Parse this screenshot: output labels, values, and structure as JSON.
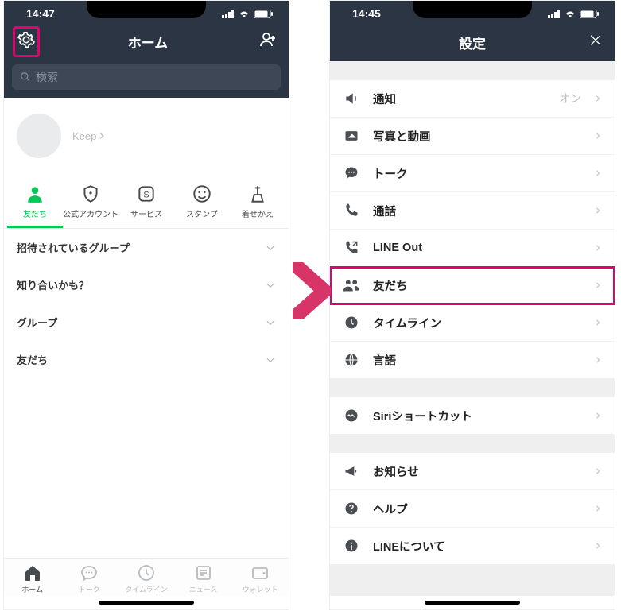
{
  "left": {
    "status_time": "14:47",
    "nav_title": "ホーム",
    "search_placeholder": "検索",
    "keep_label": "Keep",
    "tabs": [
      {
        "label": "友だち"
      },
      {
        "label": "公式アカウント"
      },
      {
        "label": "サービス"
      },
      {
        "label": "スタンプ"
      },
      {
        "label": "着せかえ"
      }
    ],
    "sections": [
      {
        "label": "招待されているグループ"
      },
      {
        "label": "知り合いかも？"
      },
      {
        "label": "グループ"
      },
      {
        "label": "友だち"
      }
    ],
    "bottom": [
      {
        "label": "ホーム"
      },
      {
        "label": "トーク"
      },
      {
        "label": "タイムライン"
      },
      {
        "label": "ニュース"
      },
      {
        "label": "ウォレット"
      }
    ]
  },
  "right": {
    "status_time": "14:45",
    "nav_title": "設定",
    "group1": [
      {
        "name": "通知",
        "value": "オン",
        "icon": "speaker"
      },
      {
        "name": "写真と動画",
        "icon": "photo"
      },
      {
        "name": "トーク",
        "icon": "chat"
      },
      {
        "name": "通話",
        "icon": "phone"
      },
      {
        "name": "LINE Out",
        "icon": "phone-out"
      },
      {
        "name": "友だち",
        "icon": "friends",
        "highlight": true
      },
      {
        "name": "タイムライン",
        "icon": "clock"
      },
      {
        "name": "言語",
        "icon": "globe"
      }
    ],
    "group2": [
      {
        "name": "Siriショートカット",
        "icon": "siri"
      }
    ],
    "group3": [
      {
        "name": "お知らせ",
        "icon": "megaphone"
      },
      {
        "name": "ヘルプ",
        "icon": "help"
      },
      {
        "name": "LINEについて",
        "icon": "info"
      }
    ]
  }
}
